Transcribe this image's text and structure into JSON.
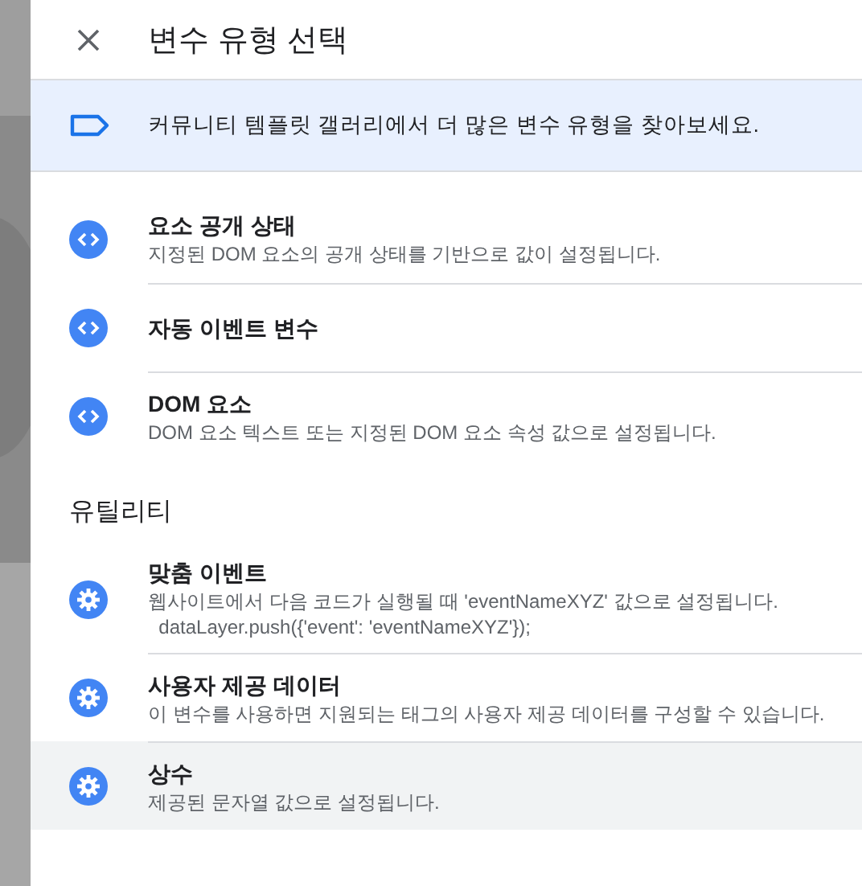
{
  "panel": {
    "title": "변수 유형 선택"
  },
  "banner": {
    "text": "커뮤니티 템플릿 갤러리에서 더 많은 변수 유형을 찾아보세요."
  },
  "sections": [
    {
      "items": [
        {
          "kind": "code",
          "title": "요소 공개 상태",
          "description": [
            "지정된 DOM 요소의 공개 상태를 기반으로 값이 설정됩니다."
          ],
          "selected": false
        },
        {
          "kind": "code",
          "title": "자동 이벤트 변수",
          "selected": false
        },
        {
          "kind": "code",
          "title": "DOM 요소",
          "description": [
            "DOM 요소 텍스트 또는 지정된 DOM 요소 속성 값으로 설정됩니다."
          ],
          "selected": false
        }
      ]
    },
    {
      "heading": "유틸리티",
      "items": [
        {
          "kind": "gear",
          "title": "맞춤 이벤트",
          "description": [
            "웹사이트에서 다음 코드가 실행될 때 'eventNameXYZ' 값으로 설정됩니다.",
            "  dataLayer.push({'event': 'eventNameXYZ'});"
          ],
          "selected": false
        },
        {
          "kind": "gear",
          "title": "사용자 제공 데이터",
          "description": [
            "이 변수를 사용하면 지원되는 태그의 사용자 제공 데이터를 구성할 수 있습니다."
          ],
          "selected": false
        },
        {
          "kind": "gear",
          "title": "상수",
          "description": [
            "제공된 문자열 값으로 설정됩니다."
          ],
          "selected": true
        }
      ]
    }
  ]
}
